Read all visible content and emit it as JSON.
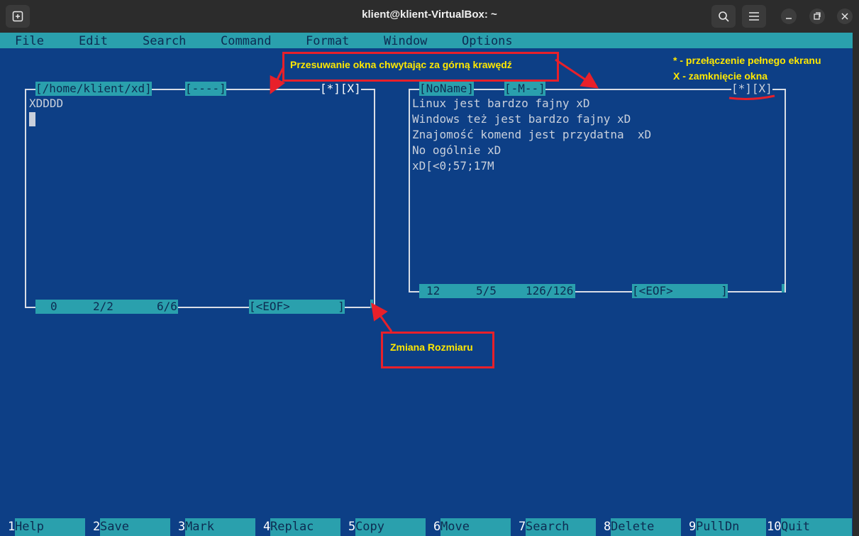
{
  "window": {
    "title": "klient@klient-VirtualBox: ~"
  },
  "menu": [
    "File",
    "Edit",
    "Search",
    "Command",
    "Format",
    "Window",
    "Options"
  ],
  "left_window": {
    "path": "[/home/klient/xd]",
    "mode": "[----]",
    "controls": "[*][X]",
    "content": [
      "XDDDD"
    ],
    "status": {
      "col": "0",
      "line": "2/2",
      "pos": "6/6",
      "eof": "[<EOF>       ]"
    }
  },
  "right_window": {
    "name": "[NoName]",
    "mode": "[-M--]",
    "controls": "[*][X]",
    "content": [
      "Linux jest bardzo fajny xD",
      "Windows też jest bardzo fajny xD",
      "Znajomość komend jest przydatna  xD",
      "No ogólnie xD",
      "xD[<0;57;17M"
    ],
    "status": {
      "col": "12",
      "line": "5/5",
      "pos": "126/126",
      "eof": "[<EOF>       ]"
    }
  },
  "annotations": {
    "move_label": "Przesuwanie okna chwytając za górną krawędź",
    "fullscreen_label": "* - przełączenie pełnego ekranu",
    "close_label": "X - zamknięcie okna",
    "resize_label": "Zmiana Rozmiaru"
  },
  "function_keys": [
    {
      "num": "1",
      "label": "Help"
    },
    {
      "num": "2",
      "label": "Save"
    },
    {
      "num": "3",
      "label": "Mark"
    },
    {
      "num": "4",
      "label": "Replac"
    },
    {
      "num": "5",
      "label": "Copy"
    },
    {
      "num": "6",
      "label": "Move"
    },
    {
      "num": "7",
      "label": "Search"
    },
    {
      "num": "8",
      "label": "Delete"
    },
    {
      "num": "9",
      "label": "PullDn"
    },
    {
      "num": "10",
      "label": "Quit"
    }
  ],
  "colors": {
    "background": "#0d3f86",
    "highlight": "#2aa0ad",
    "annotation": "#ffe800",
    "annotation_box": "#e8202a"
  }
}
